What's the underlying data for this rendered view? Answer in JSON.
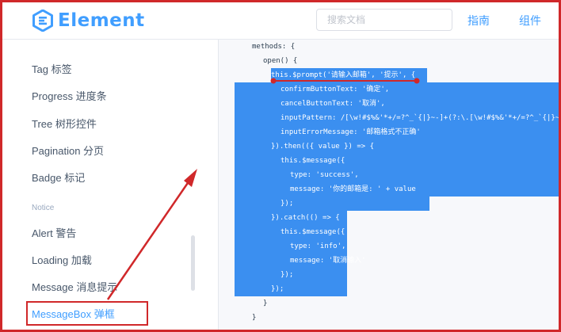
{
  "header": {
    "logo_text": "Element",
    "search_placeholder": "搜索文档",
    "nav_guide": "指南",
    "nav_components": "组件"
  },
  "sidebar": {
    "items": [
      {
        "label": "Tag 标签"
      },
      {
        "label": "Progress 进度条"
      },
      {
        "label": "Tree 树形控件"
      },
      {
        "label": "Pagination 分页"
      },
      {
        "label": "Badge 标记"
      }
    ],
    "group": "Notice",
    "notice_items": [
      {
        "label": "Alert 警告"
      },
      {
        "label": "Loading 加载"
      },
      {
        "label": "Message 消息提示"
      },
      {
        "label": "MessageBox 弹框"
      }
    ]
  },
  "code": {
    "lines": [
      "methods: {",
      "open() {",
      "this.$prompt('请输入邮箱', '提示', {",
      "confirmButtonText: '确定',",
      "cancelButtonText: '取消',",
      "inputPattern: /[\\w!#$%&'*+/=?^_`{|}~-]+(?:\\.[\\w!#$%&'*+/=?^_`{|}~-]+)*/,",
      "inputErrorMessage: '邮箱格式不正确'",
      "}).then(({ value }) => {",
      "this.$message({",
      "type: 'success',",
      "message: '你的邮箱是: ' + value",
      "});",
      "}).catch(() => {",
      "this.$message({",
      "type: 'info',",
      "message: '取消输入'",
      "});",
      "});",
      "}",
      "}"
    ]
  },
  "colors": {
    "accent": "#409eff",
    "annotation_red": "#d0282a",
    "selection": "#3b8ff0"
  },
  "icons": {
    "logo": "element-logo-icon"
  }
}
